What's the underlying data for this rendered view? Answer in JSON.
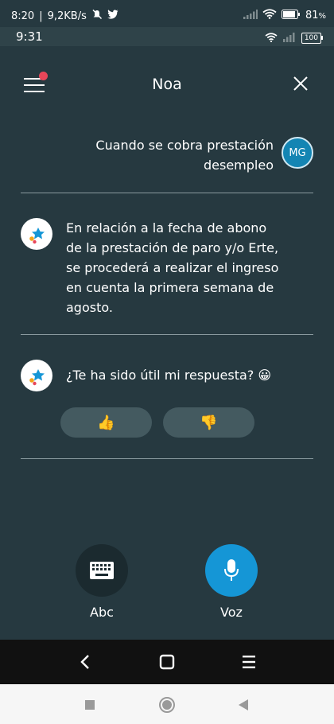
{
  "outer_status": {
    "time": "8:20",
    "network_speed": "9,2KB/s",
    "battery": "81",
    "battery_unit": "%"
  },
  "inner_status": {
    "time": "9:31",
    "battery": "100"
  },
  "header": {
    "title": "Noa",
    "menu_icon": "hamburger-menu-icon",
    "notification_dot": true,
    "close_icon": "close-icon"
  },
  "conversation": {
    "user_message": {
      "lines": [
        "Cuando se cobra prestación",
        "desempleo"
      ],
      "avatar_initials": "MG"
    },
    "bot_message": {
      "lines": [
        "En relación a la fecha de abono",
        "de la prestación de paro y/o Erte,",
        "se procederá a realizar el ingreso",
        "en cuenta la primera semana de",
        "agosto."
      ]
    },
    "bot_question": {
      "text": "¿Te ha sido útil mi respuesta?",
      "emoji": "😀"
    },
    "feedback": {
      "thumbs_up": "👍",
      "thumbs_down": "👎"
    }
  },
  "actions": {
    "keyboard_label": "Abc",
    "voice_label": "Voz"
  },
  "colors": {
    "app_background": "#263940",
    "accent_blue": "#1596d6",
    "notification_red": "#e84659",
    "user_avatar": "#1485b3"
  }
}
